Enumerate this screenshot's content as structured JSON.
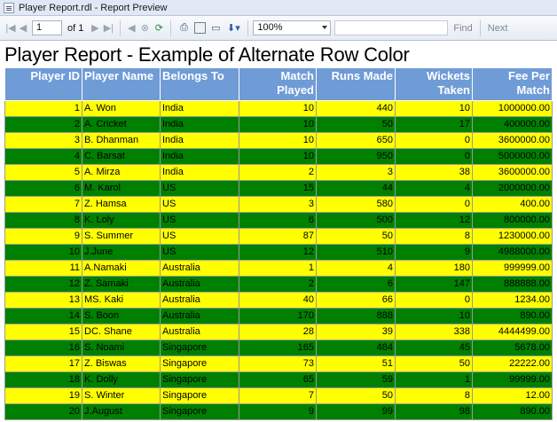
{
  "window": {
    "title": "Player Report.rdl - Report Preview"
  },
  "toolbar": {
    "page_current": "1",
    "page_of": "of 1",
    "zoom": "100%",
    "find_label": "Find",
    "next_label": "Next"
  },
  "report": {
    "title": "Player Report - Example of Alternate Row Color",
    "colors": {
      "header": "#6f9bd7",
      "odd_row": "#ffff00",
      "even_row": "#008000"
    },
    "columns": [
      "Player ID",
      "Player Name",
      "Belongs To",
      "Match Played",
      "Runs Made",
      "Wickets Taken",
      "Fee Per Match"
    ],
    "rows": [
      [
        "1",
        "A. Won",
        "India",
        "10",
        "440",
        "10",
        "1000000.00"
      ],
      [
        "2",
        "A. Cricket",
        "India",
        "10",
        "50",
        "17",
        "400000.00"
      ],
      [
        "3",
        "B. Dhanman",
        "India",
        "10",
        "650",
        "0",
        "3600000.00"
      ],
      [
        "4",
        "C. Barsat",
        "India",
        "10",
        "950",
        "0",
        "5000000.00"
      ],
      [
        "5",
        "A. Mirza",
        "India",
        "2",
        "3",
        "38",
        "3600000.00"
      ],
      [
        "6",
        "M. Karol",
        "US",
        "15",
        "44",
        "4",
        "2000000.00"
      ],
      [
        "7",
        "Z. Hamsa",
        "US",
        "3",
        "580",
        "0",
        "400.00"
      ],
      [
        "8",
        "K. Loly",
        "US",
        "6",
        "500",
        "12",
        "800000.00"
      ],
      [
        "9",
        "S. Summer",
        "US",
        "87",
        "50",
        "8",
        "1230000.00"
      ],
      [
        "10",
        "J.June",
        "US",
        "12",
        "510",
        "9",
        "4988000.00"
      ],
      [
        "11",
        "A.Namaki",
        "Australia",
        "1",
        "4",
        "180",
        "999999.00"
      ],
      [
        "12",
        "Z. Samaki",
        "Australia",
        "2",
        "6",
        "147",
        "888888.00"
      ],
      [
        "13",
        "MS. Kaki",
        "Australia",
        "40",
        "66",
        "0",
        "1234.00"
      ],
      [
        "14",
        "S. Boon",
        "Australia",
        "170",
        "888",
        "10",
        "890.00"
      ],
      [
        "15",
        "DC. Shane",
        "Australia",
        "28",
        "39",
        "338",
        "4444499.00"
      ],
      [
        "16",
        "S. Noami",
        "Singapore",
        "165",
        "484",
        "45",
        "5678.00"
      ],
      [
        "17",
        "Z. Biswas",
        "Singapore",
        "73",
        "51",
        "50",
        "22222.00"
      ],
      [
        "18",
        "K. Dolly",
        "Singapore",
        "65",
        "59",
        "1",
        "99999.00"
      ],
      [
        "19",
        "S. Winter",
        "Singapore",
        "7",
        "50",
        "8",
        "12.00"
      ],
      [
        "20",
        "J.August",
        "Singapore",
        "9",
        "99",
        "98",
        "890.00"
      ]
    ]
  }
}
